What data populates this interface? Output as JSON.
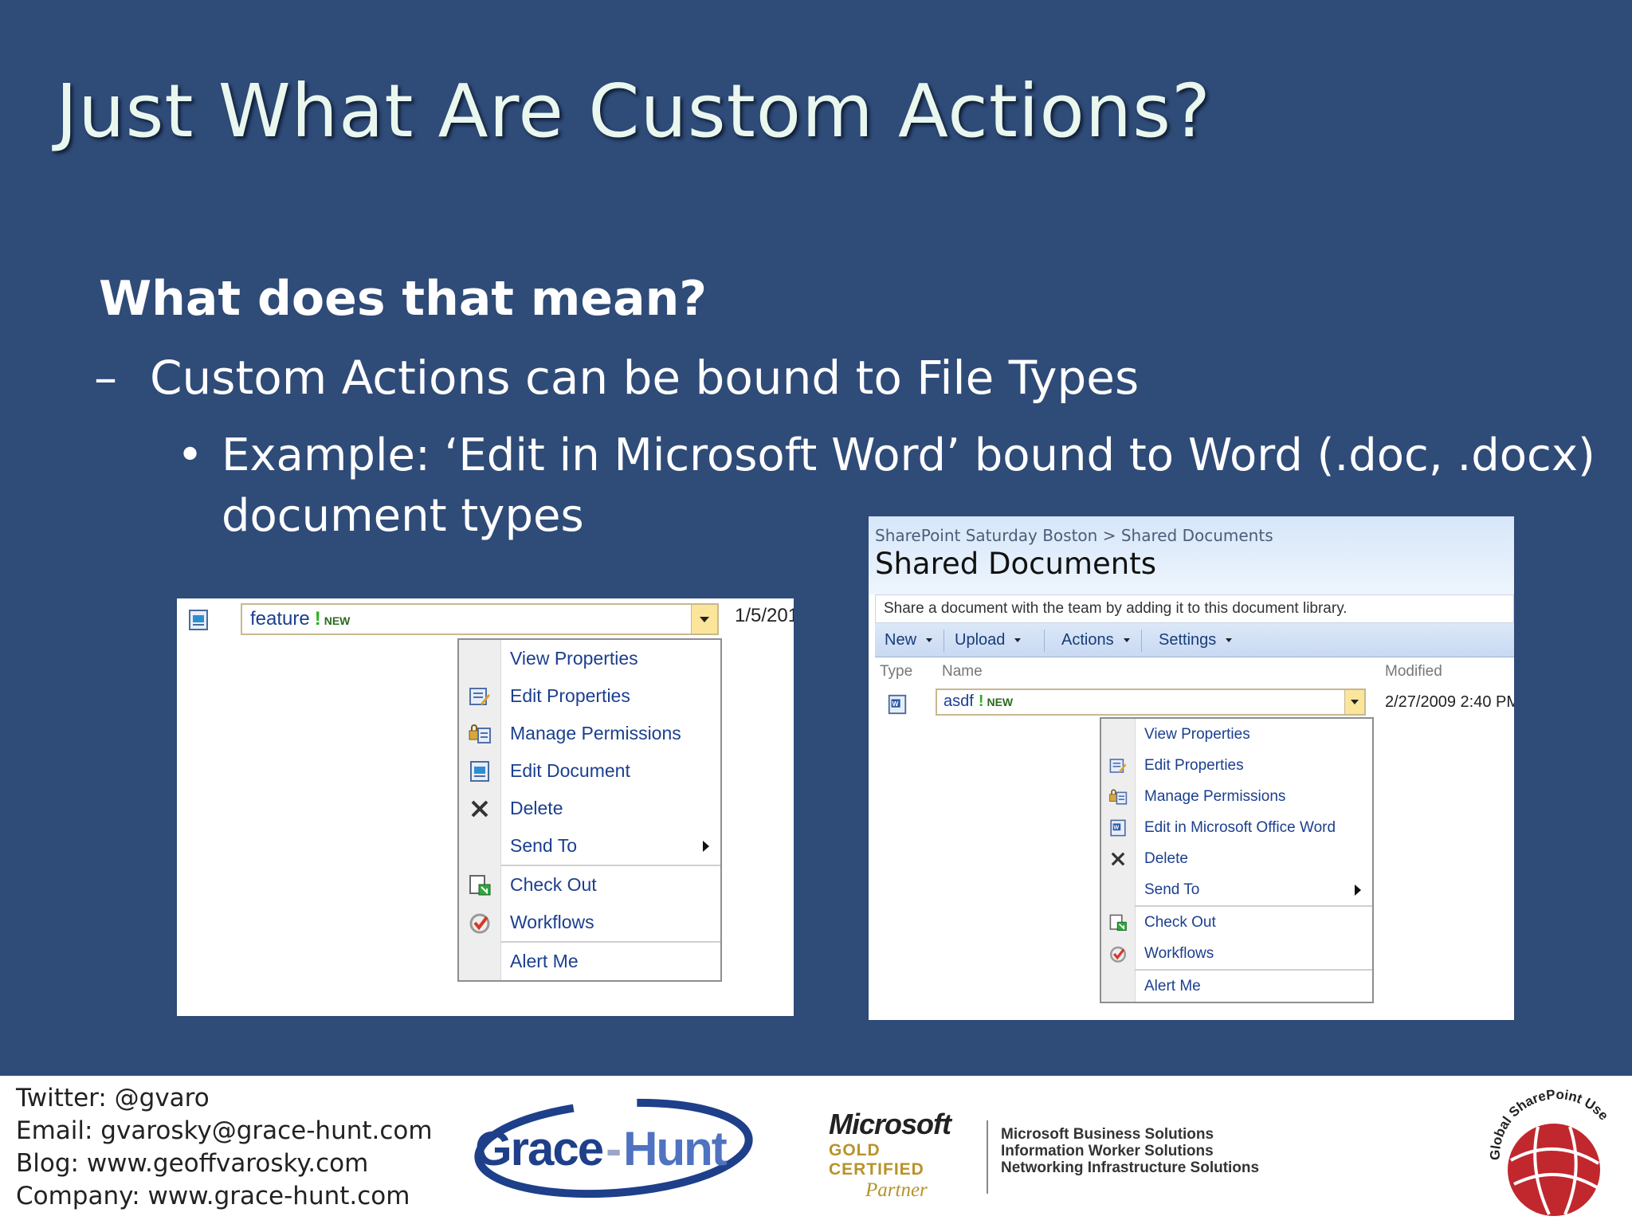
{
  "slide": {
    "title": "Just What Are Custom Actions?",
    "heading": "What does that mean?",
    "dash_marker": "–",
    "point": "Custom Actions can be bound to File Types",
    "bullet_marker": "•",
    "subpoint_line1": "Example: ‘Edit in Microsoft Word’ bound to Word (.doc, .docx)",
    "subpoint_line2": "document types"
  },
  "left_screenshot": {
    "item_name": "feature",
    "new_tag": "NEW",
    "date": "1/5/201",
    "menu": [
      {
        "label": "View Properties",
        "icon": "none"
      },
      {
        "label": "Edit Properties",
        "icon": "edit-properties-icon"
      },
      {
        "label": "Manage Permissions",
        "icon": "permissions-icon"
      },
      {
        "label": "Edit Document",
        "icon": "document-icon"
      },
      {
        "label": "Delete",
        "icon": "delete-x-icon"
      },
      {
        "label": "Send To",
        "icon": "none",
        "submenu": true
      },
      {
        "label": "Check Out",
        "icon": "check-out-icon"
      },
      {
        "label": "Workflows",
        "icon": "workflow-icon"
      },
      {
        "label": "Alert Me",
        "icon": "none"
      }
    ]
  },
  "right_screenshot": {
    "breadcrumb": "SharePoint Saturday Boston > Shared Documents",
    "page_title": "Shared Documents",
    "description": "Share a document with the team by adding it to this document library.",
    "toolbar": {
      "new": "New",
      "upload": "Upload",
      "actions": "Actions",
      "settings": "Settings"
    },
    "columns": {
      "type": "Type",
      "name": "Name",
      "modified": "Modified"
    },
    "item_name": "asdf",
    "new_tag": "NEW",
    "modified": "2/27/2009 2:40 PM",
    "menu": [
      {
        "label": "View Properties",
        "icon": "none"
      },
      {
        "label": "Edit Properties",
        "icon": "edit-properties-icon"
      },
      {
        "label": "Manage Permissions",
        "icon": "permissions-icon"
      },
      {
        "label": "Edit in Microsoft Office Word",
        "icon": "word-icon"
      },
      {
        "label": "Delete",
        "icon": "delete-x-icon"
      },
      {
        "label": "Send To",
        "icon": "none",
        "submenu": true
      },
      {
        "label": "Check Out",
        "icon": "check-out-icon"
      },
      {
        "label": "Workflows",
        "icon": "workflow-icon"
      },
      {
        "label": "Alert Me",
        "icon": "none"
      }
    ]
  },
  "footer": {
    "twitter": "Twitter: @gvaro",
    "email": "Email: gvarosky@grace-hunt.com",
    "blog": "Blog: www.geoffvarosky.com",
    "company": "Company: www.grace-hunt.com",
    "logo_text_left": "Grace",
    "logo_text_sep": "-",
    "logo_text_right": "Hunt",
    "ms_name": "Microsoft",
    "ms_certified": "GOLD CERTIFIED",
    "ms_partner": "Partner",
    "solutions": [
      "Microsoft Business Solutions",
      "Information Worker Solutions",
      "Networking Infrastructure Solutions"
    ],
    "gsug_text": "Global SharePoint Users Group"
  },
  "colors": {
    "slide_bg": "#2f4b78",
    "title": "#e9f7ef",
    "menu_text": "#1b3f8f",
    "gold": "#b8932a",
    "gsug_red": "#c0282e"
  }
}
